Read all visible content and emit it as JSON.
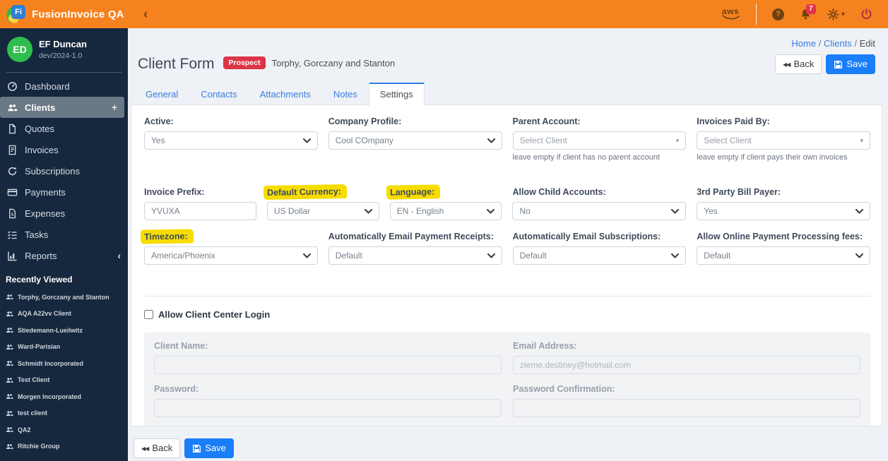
{
  "colors": {
    "topbar_orange": "#f5821f",
    "sidebar_navy": "#16283e",
    "link_blue": "#3b7ddd",
    "save_blue": "#1a7ef8",
    "badge_red": "#dc3545",
    "notification_red": "#e8324a",
    "highlight_yellow": "#f7dc00",
    "avatar_green": "#2fbe4e"
  },
  "topbar": {
    "brand": "FusionInvoice QA",
    "aws_label": "aws",
    "notification_count": "7",
    "help_glyph": "?",
    "collapse_glyph": "‹",
    "gear_caret": "▾"
  },
  "sidebar": {
    "user": {
      "initials": "ED",
      "name": "EF Duncan",
      "version": "dev/2024-1.0"
    },
    "items": [
      {
        "label": "Dashboard"
      },
      {
        "label": "Clients",
        "suffix": "+"
      },
      {
        "label": "Quotes"
      },
      {
        "label": "Invoices"
      },
      {
        "label": "Subscriptions"
      },
      {
        "label": "Payments"
      },
      {
        "label": "Expenses"
      },
      {
        "label": "Tasks"
      },
      {
        "label": "Reports",
        "suffix": "‹"
      }
    ],
    "recent_title": "Recently Viewed",
    "recent": [
      "Torphy, Gorczany and Stanton",
      "AQA A22vv Client",
      "Stiedemann-Lueilwitz",
      "Ward-Parisian",
      "Schmidt Incorporated",
      "Test Client",
      "Morgen Incorporated",
      "test client",
      "QA2",
      "Ritchie Group"
    ]
  },
  "breadcrumb": {
    "home": "Home",
    "clients": "Clients",
    "edit": "Edit",
    "separator": "/"
  },
  "header": {
    "title": "Client Form",
    "badge": "Prospect",
    "client_name": "Torphy, Gorczany and Stanton",
    "back_label": "Back",
    "save_label": "Save",
    "back_glyph": "◀◀"
  },
  "tabs": [
    {
      "label": "General"
    },
    {
      "label": "Contacts"
    },
    {
      "label": "Attachments"
    },
    {
      "label": "Notes"
    },
    {
      "label": "Settings"
    }
  ],
  "form": {
    "active": {
      "label": "Active:",
      "value": "Yes"
    },
    "company_profile": {
      "label": "Company Profile:",
      "value": "Cool COmpany"
    },
    "parent_account": {
      "label": "Parent Account:",
      "value": "Select Client",
      "helper": "leave empty if client has no parent account"
    },
    "invoices_paid_by": {
      "label": "Invoices Paid By:",
      "value": "Select Client",
      "helper": "leave empty if client pays their own invoices"
    },
    "invoice_prefix": {
      "label": "Invoice Prefix:",
      "value": "YVUXA"
    },
    "default_currency": {
      "label": "Default Currency:",
      "value": "US Dollar"
    },
    "language": {
      "label": "Language:",
      "value": "EN - English"
    },
    "allow_child_accounts": {
      "label": "Allow Child Accounts:",
      "value": "No"
    },
    "third_party_bill_payer": {
      "label": "3rd Party Bill Payer:",
      "value": "Yes"
    },
    "timezone": {
      "label": "Timezone:",
      "value": "America/Phoenix"
    },
    "auto_email_payment_receipts": {
      "label": "Automatically Email Payment Receipts:",
      "value": "Default"
    },
    "auto_email_subscriptions": {
      "label": "Automatically Email Subscriptions:",
      "value": "Default"
    },
    "allow_online_payment_fees": {
      "label": "Allow Online Payment Processing fees:",
      "value": "Default"
    }
  },
  "login": {
    "checkbox_label": "Allow Client Center Login",
    "client_name_label": "Client Name:",
    "email_label": "Email Address:",
    "email_value": "zieme.destiney@hotmail.com",
    "password_label": "Password:",
    "password_confirmation_label": "Password Confirmation:"
  },
  "footer": {
    "back_label": "Back",
    "save_label": "Save"
  }
}
